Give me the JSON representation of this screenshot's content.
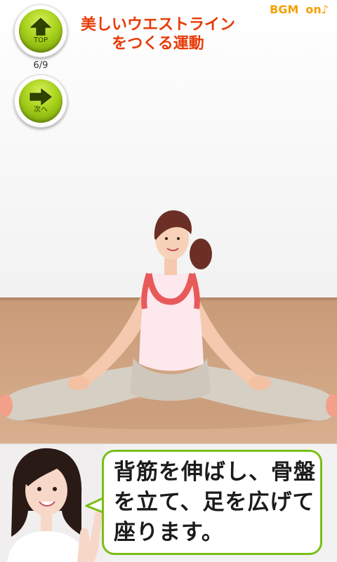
{
  "header": {
    "title_line1": "美しいウエストライン",
    "title_line2": "をつくる運動",
    "bgm_label": "BGM",
    "bgm_state": "on♪"
  },
  "nav": {
    "top_label": "TOP",
    "next_label": "次へ",
    "counter": "6/9"
  },
  "instruction": {
    "line1": "背筋を伸ばし、骨盤",
    "line2": "を立て、足を広げて",
    "line3": "座ります。"
  },
  "colors": {
    "title": "#e83a07",
    "bgm": "#f5a100",
    "button_green": "#a7d11b",
    "bubble_border": "#7bbf13",
    "floor": "#d2a785"
  },
  "icons": {
    "top": "arrow-up-icon",
    "next": "arrow-right-icon"
  }
}
